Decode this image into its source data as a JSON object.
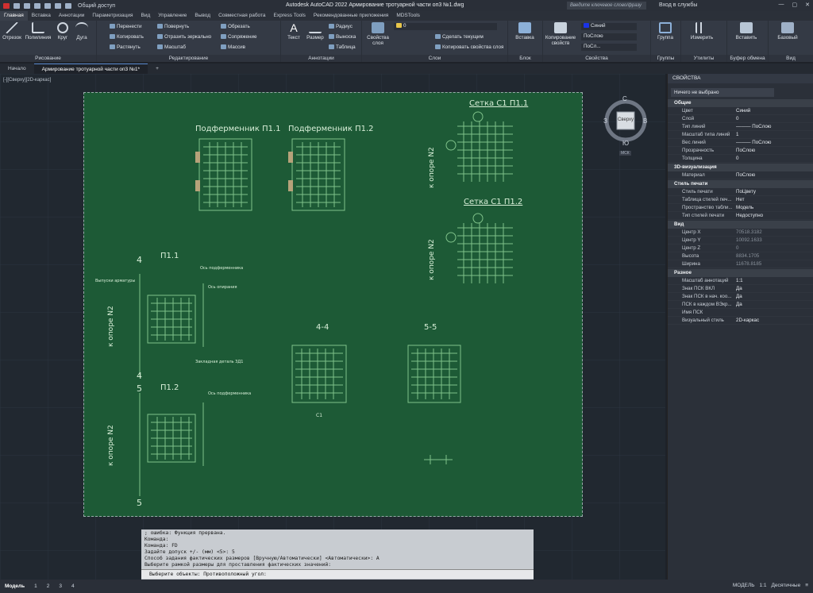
{
  "titlebar": {
    "share": "Общий доступ",
    "title": "Autodesk AutoCAD 2022   Армирование тротуарной части оп3 №1.dwg",
    "search_placeholder": "Введите ключевое слово/фразу",
    "login": "Вход в службы"
  },
  "ribbon_tabs": [
    "Главная",
    "Вставка",
    "Аннотации",
    "Параметризация",
    "Вид",
    "Управление",
    "Вывод",
    "Совместная работа",
    "Express Tools",
    "Рекомендованные приложения",
    "MDSTools"
  ],
  "panels": {
    "draw": {
      "title": "Рисование",
      "items": [
        "Отрезок",
        "Полилиния",
        "Круг",
        "Дуга"
      ]
    },
    "modify": {
      "title": "Редактирование",
      "items": [
        "Перенести",
        "Повернуть",
        "Обрезать",
        "Копировать",
        "Отразить зеркально",
        "Сопряжение",
        "Растянуть",
        "Масштаб",
        "Массив"
      ]
    },
    "annot": {
      "title": "Аннотации",
      "items": [
        "Текст",
        "Размер",
        "Радиус",
        "Выноска",
        "Таблица"
      ]
    },
    "layers": {
      "title": "Слои",
      "items": [
        "Свойства слоя",
        "Сделать текущим",
        "Копировать свойства слоя"
      ],
      "current": "0"
    },
    "block": {
      "title": "Блок",
      "items": [
        "Вставка"
      ]
    },
    "properties": {
      "title": "Свойства",
      "items": [
        "Копирование свойств"
      ],
      "color": "Синий",
      "linetype": "ПоСлою",
      "lineweight": "ПоСл..."
    },
    "groups": {
      "title": "Группы",
      "items": [
        "Группа"
      ]
    },
    "utilities": {
      "title": "Утилиты",
      "items": [
        "Измерить"
      ]
    },
    "clipboard": {
      "title": "Буфер обмена",
      "items": [
        "Вставить"
      ]
    },
    "view": {
      "title": "Вид",
      "items": [
        "Базовый"
      ]
    }
  },
  "doc_tabs": [
    "Начало",
    "Армирование тротуарной части оп3 №1*"
  ],
  "view_label": "[-][Сверху][2D-каркас]",
  "nav": {
    "n": "С",
    "s": "Ю",
    "w": "З",
    "e": "В",
    "center": "Сверху",
    "ucs": "МСК"
  },
  "drawing": {
    "titles": [
      "Подферменник П1.1",
      "Подферменник П1.2",
      "Сетка С1 П1.1",
      "Сетка С1 П1.2",
      "П1.1",
      "П1.2",
      "4-4",
      "5-5"
    ],
    "section_marks": [
      "4",
      "4",
      "5",
      "5"
    ],
    "support_labels": [
      "к опоре N2",
      "к опоре N2",
      "к опоре N2",
      "к опоре N2"
    ],
    "notes": [
      "Выпуски арматуры",
      "Ось подферменника",
      "Ось подферменника",
      "Ось опирания",
      "Закладная деталь ЗД1",
      "C1"
    ]
  },
  "properties_panel": {
    "header": "СВОЙСТВА",
    "selection": "Ничего не выбрано",
    "groups": [
      {
        "name": "Общие",
        "rows": [
          [
            "Цвет",
            "Синий"
          ],
          [
            "Слой",
            "0"
          ],
          [
            "Тип линий",
            "——— ПоСлою"
          ],
          [
            "Масштаб типа линий",
            "1"
          ],
          [
            "Вес линий",
            "——— ПоСлою"
          ],
          [
            "Прозрачность",
            "ПоСлою"
          ],
          [
            "Толщина",
            "0"
          ]
        ]
      },
      {
        "name": "3D-визуализация",
        "rows": [
          [
            "Материал",
            "ПоСлою"
          ]
        ]
      },
      {
        "name": "Стиль печати",
        "rows": [
          [
            "Стиль печати",
            "ПоЦвету"
          ],
          [
            "Таблица стилей печ...",
            "Нет"
          ],
          [
            "Пространство табли...",
            "Модель"
          ],
          [
            "Тип стилей печати",
            "Недоступно"
          ]
        ]
      },
      {
        "name": "Вид",
        "rows": [
          [
            "Центр X",
            "70518.3182"
          ],
          [
            "Центр Y",
            "10092.1633"
          ],
          [
            "Центр Z",
            "0"
          ],
          [
            "Высота",
            "8834.1705"
          ],
          [
            "Ширина",
            "11678.8185"
          ]
        ]
      },
      {
        "name": "Разное",
        "rows": [
          [
            "Масштаб аннотаций",
            "1:1"
          ],
          [
            "Знак ПСК ВКЛ",
            "Да"
          ],
          [
            "Знак ПСК в нач. коо...",
            "Да"
          ],
          [
            "ПСК в каждом ВЭкр...",
            "Да"
          ],
          [
            "Имя ПСК",
            ""
          ],
          [
            "Визуальный стиль",
            "2D-каркас"
          ]
        ]
      }
    ]
  },
  "command": {
    "lines": [
      "; ошибка: Функция прервана.",
      "Команда:",
      "Команда: FD",
      "Задайте допуск +/- (мм) <5>: 5",
      "Способ задания фактических размеров [Вручную/Автоматически] <Автоматически>: А",
      "Выберите рамкой размеры для проставления фактических значений:"
    ],
    "prompt": "Выберите объекты: Противоположный угол:"
  },
  "status": {
    "layouts": [
      "Модель",
      "1",
      "2",
      "3",
      "4"
    ],
    "model": "МОДЕЛЬ",
    "units": "Десятичные",
    "scale": "1:1"
  }
}
